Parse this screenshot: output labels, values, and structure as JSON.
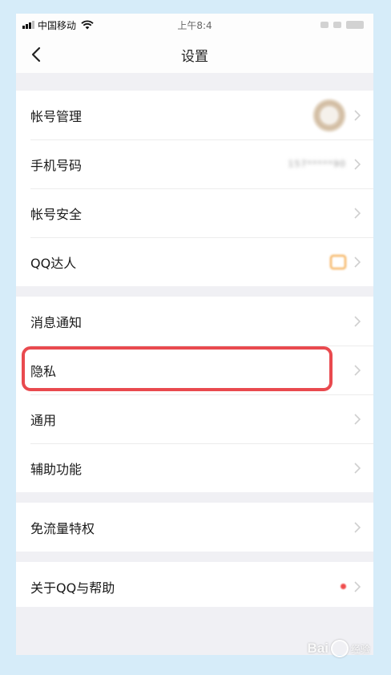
{
  "status_bar": {
    "carrier": "中国移动",
    "time": "上午8:4"
  },
  "nav": {
    "title": "设置"
  },
  "groups": [
    {
      "items": [
        {
          "label": "帐号管理"
        },
        {
          "label": "手机号码",
          "value": "157*****90"
        },
        {
          "label": "帐号安全"
        },
        {
          "label": "QQ达人"
        }
      ]
    },
    {
      "items": [
        {
          "label": "消息通知"
        },
        {
          "label": "隐私"
        },
        {
          "label": "通用"
        },
        {
          "label": "辅助功能"
        }
      ]
    },
    {
      "items": [
        {
          "label": "免流量特权"
        }
      ]
    },
    {
      "items": [
        {
          "label": "关于QQ与帮助"
        }
      ]
    }
  ],
  "colors": {
    "highlight": "#e94a4f",
    "page_background": "#d6ecf9",
    "list_background": "#f0f0f4",
    "badge_orange": "#f3a23b",
    "notification_dot": "#f04e4e"
  },
  "watermark": {
    "brand": "Bai",
    "suffix": "经验"
  }
}
